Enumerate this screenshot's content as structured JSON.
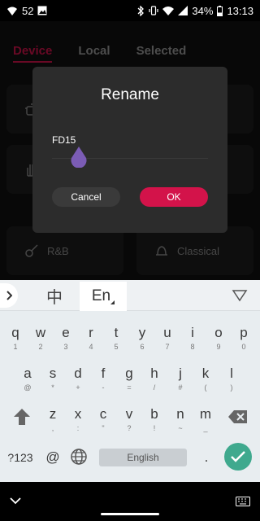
{
  "status": {
    "notification_count": "52",
    "battery": "34%",
    "time": "13:13"
  },
  "app": {
    "tabs": [
      {
        "label": "Device",
        "active": true
      },
      {
        "label": "Local",
        "active": false
      },
      {
        "label": "Selected",
        "active": false
      }
    ],
    "cards": [
      {
        "label": "",
        "icon": "pot-icon"
      },
      {
        "label": "",
        "icon": "card-icon"
      },
      {
        "label": "",
        "icon": "hand-icon"
      },
      {
        "label": "",
        "icon": "card-icon"
      },
      {
        "label": "R&B",
        "icon": "guitar-icon"
      },
      {
        "label": "Classical",
        "icon": "bell-icon"
      }
    ],
    "accent_color": "#d3134a"
  },
  "dialog": {
    "title": "Rename",
    "field_value": "FD15",
    "cancel_label": "Cancel",
    "ok_label": "OK"
  },
  "keyboard": {
    "lang_chinese": "中",
    "lang_english": "En",
    "row1": [
      {
        "main": "q",
        "sub": "1"
      },
      {
        "main": "w",
        "sub": "2"
      },
      {
        "main": "e",
        "sub": "3"
      },
      {
        "main": "r",
        "sub": "4"
      },
      {
        "main": "t",
        "sub": "5"
      },
      {
        "main": "y",
        "sub": "6"
      },
      {
        "main": "u",
        "sub": "7"
      },
      {
        "main": "i",
        "sub": "8"
      },
      {
        "main": "o",
        "sub": "9"
      },
      {
        "main": "p",
        "sub": "0"
      }
    ],
    "row2": [
      {
        "main": "a",
        "sub": "@"
      },
      {
        "main": "s",
        "sub": "*"
      },
      {
        "main": "d",
        "sub": "+"
      },
      {
        "main": "f",
        "sub": "-"
      },
      {
        "main": "g",
        "sub": "="
      },
      {
        "main": "h",
        "sub": "/"
      },
      {
        "main": "j",
        "sub": "#"
      },
      {
        "main": "k",
        "sub": "("
      },
      {
        "main": "l",
        "sub": ")"
      }
    ],
    "row3": [
      {
        "main": "z",
        "sub": ","
      },
      {
        "main": "x",
        "sub": ":"
      },
      {
        "main": "c",
        "sub": "\""
      },
      {
        "main": "v",
        "sub": "?"
      },
      {
        "main": "b",
        "sub": "!"
      },
      {
        "main": "n",
        "sub": "~"
      },
      {
        "main": "m",
        "sub": "_"
      }
    ],
    "symbols_label": "?123",
    "at_label": "@",
    "space_label": "English",
    "period_label": ".",
    "enter_color": "#3fa98e"
  }
}
